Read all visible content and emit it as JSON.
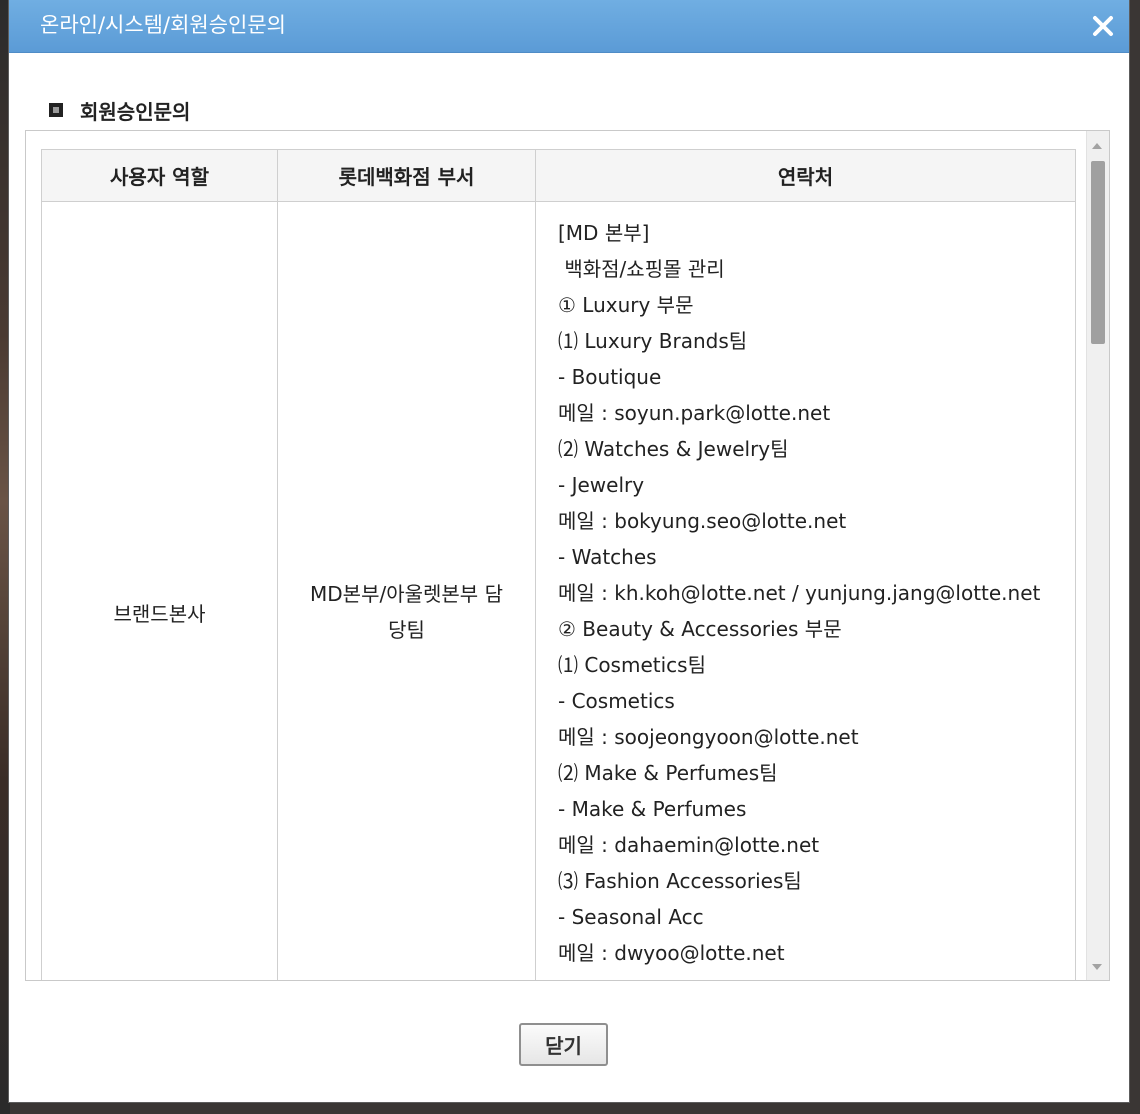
{
  "window": {
    "title": "온라인/시스템/회원승인문의",
    "close_icon": "close-icon"
  },
  "section": {
    "title": "회원승인문의"
  },
  "table": {
    "headers": [
      "사용자 역할",
      "롯데백화점 부서",
      "연락처"
    ],
    "row": {
      "role": "브랜드본사",
      "department_lines": [
        "MD본부/아울렛본부 담",
        "당팀"
      ],
      "contacts": [
        "[MD 본부]",
        " 백화점/쇼핑몰 관리",
        "① Luxury 부문",
        "⑴ Luxury Brands팀",
        "- Boutique",
        "메일 : soyun.park@lotte.net",
        "⑵ Watches & Jewelry팀",
        "- Jewelry",
        "메일 : bokyung.seo@lotte.net",
        "- Watches",
        "메일 : kh.koh@lotte.net / yunjung.jang@lotte.net",
        "② Beauty & Accessories 부문",
        "⑴ Cosmetics팀",
        "- Cosmetics",
        "메일 : soojeongyoon@lotte.net",
        "⑵ Make & Perfumes팀",
        "- Make & Perfumes",
        "메일 : dahaemin@lotte.net",
        "⑶ Fashion Accessories팀",
        "- Seasonal Acc",
        "메일 : dwyoo@lotte.net"
      ]
    }
  },
  "footer": {
    "close_label": "닫기"
  },
  "colors": {
    "titlebar": "#5b9bd6",
    "header_bg": "#f5f5f5",
    "border": "#cfcfcf"
  }
}
